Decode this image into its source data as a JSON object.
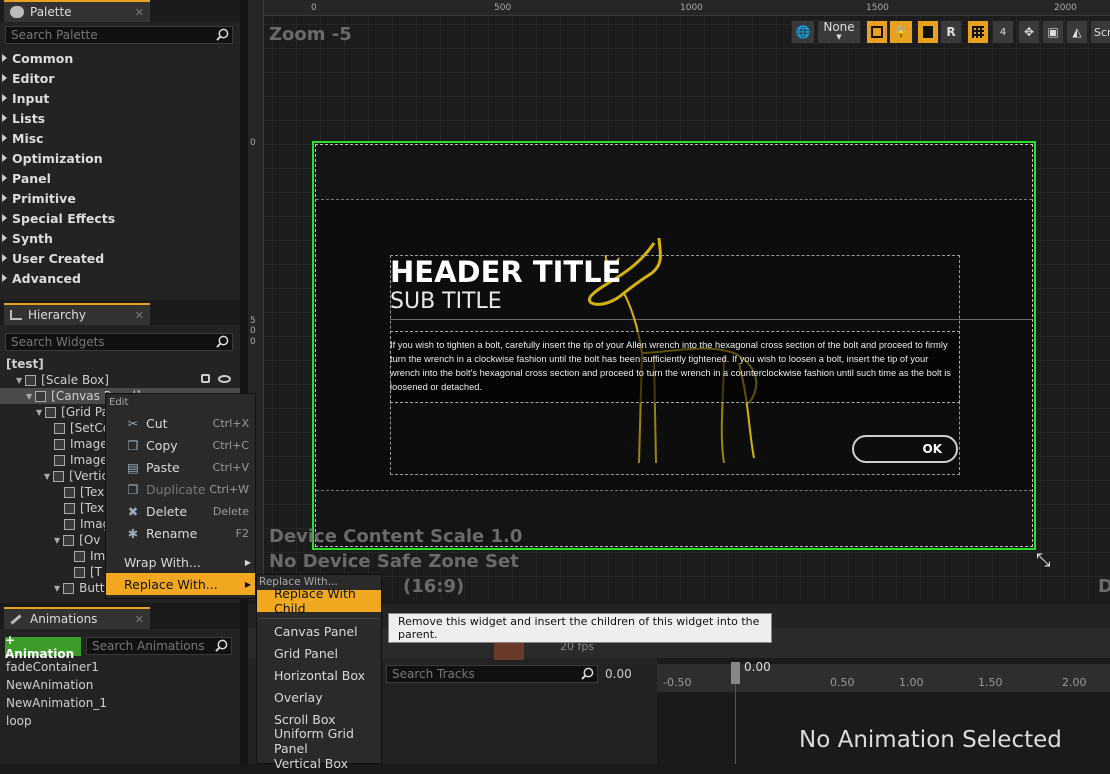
{
  "palette": {
    "tab": "Palette",
    "search_placeholder": "Search Palette",
    "categories": [
      "Common",
      "Editor",
      "Input",
      "Lists",
      "Misc",
      "Optimization",
      "Panel",
      "Primitive",
      "Special Effects",
      "Synth",
      "User Created",
      "Advanced"
    ]
  },
  "hierarchy": {
    "tab": "Hierarchy",
    "search_placeholder": "Search Widgets",
    "items": [
      "[test]",
      "[Scale Box]",
      "[Canvas Panel]",
      "[Grid Pa",
      "[SetCo",
      "Image",
      "Image",
      "[Vertic",
      "[Tex",
      "[Tex",
      "Imag",
      "[Ov",
      "Im",
      "[T",
      "Butt"
    ]
  },
  "context_menu": {
    "header": "Edit",
    "items": [
      {
        "label": "Cut",
        "shortcut": "Ctrl+X"
      },
      {
        "label": "Copy",
        "shortcut": "Ctrl+C"
      },
      {
        "label": "Paste",
        "shortcut": "Ctrl+V"
      },
      {
        "label": "Duplicate",
        "shortcut": "Ctrl+W"
      },
      {
        "label": "Delete",
        "shortcut": "Delete"
      },
      {
        "label": "Rename",
        "shortcut": "F2"
      }
    ],
    "wrap_with": "Wrap With...",
    "replace_with": "Replace With..."
  },
  "submenu": {
    "header": "Replace With...",
    "highlight": "Replace With Child",
    "items": [
      "Canvas Panel",
      "Grid Panel",
      "Horizontal Box",
      "Overlay",
      "Scroll Box",
      "Uniform Grid Panel",
      "Vertical Box"
    ]
  },
  "tooltip": "Remove this widget and insert the children of this widget into the parent.",
  "designer": {
    "zoom": "Zoom -5",
    "ruler_top": [
      "0",
      "500",
      "1000",
      "1500",
      "2000"
    ],
    "ruler_left": [
      "0",
      "5",
      "0",
      "0"
    ],
    "none_label": "None",
    "r_label": "R",
    "scr_label": "Scr",
    "status": [
      "Device Content Scale 1.0",
      "No Device Safe Zone Set",
      "(16:9)"
    ],
    "right_edge": "D"
  },
  "dialog": {
    "header_title": "HEADER TITLE",
    "sub_title": "SUB TITLE",
    "body": "If you wish to tighten a bolt, carefully insert the tip of your Allen wrench into the hexagonal cross section of the bolt and proceed to firmly turn the wrench in a clockwise fashion until the bolt has been sufficiently tightened. If you wish to loosen a bolt, insert the tip of your wrench into the bolt's hexagonal cross section and proceed to turn the wrench in a counterclockwise fashion until such time as the bolt is loosened or detached.",
    "ok": "OK"
  },
  "animations": {
    "tab": "Animations",
    "add_button": "+ Animation",
    "search_placeholder": "Search Animations",
    "items": [
      "fadeContainer1",
      "NewAnimation",
      "NewAnimation_1",
      "loop"
    ]
  },
  "timeline": {
    "search_placeholder": "Search Tracks",
    "time": "0.00",
    "playhead": "0.00",
    "fps": "20 fps",
    "ticks": [
      "-0.50",
      "0.50",
      "1.00",
      "1.50",
      "2.00"
    ],
    "no_anim": "No Animation Selected"
  },
  "colors": {
    "accent": "#f0a820",
    "selection_green": "#29e02c",
    "deer_yellow": "#d4b210"
  }
}
